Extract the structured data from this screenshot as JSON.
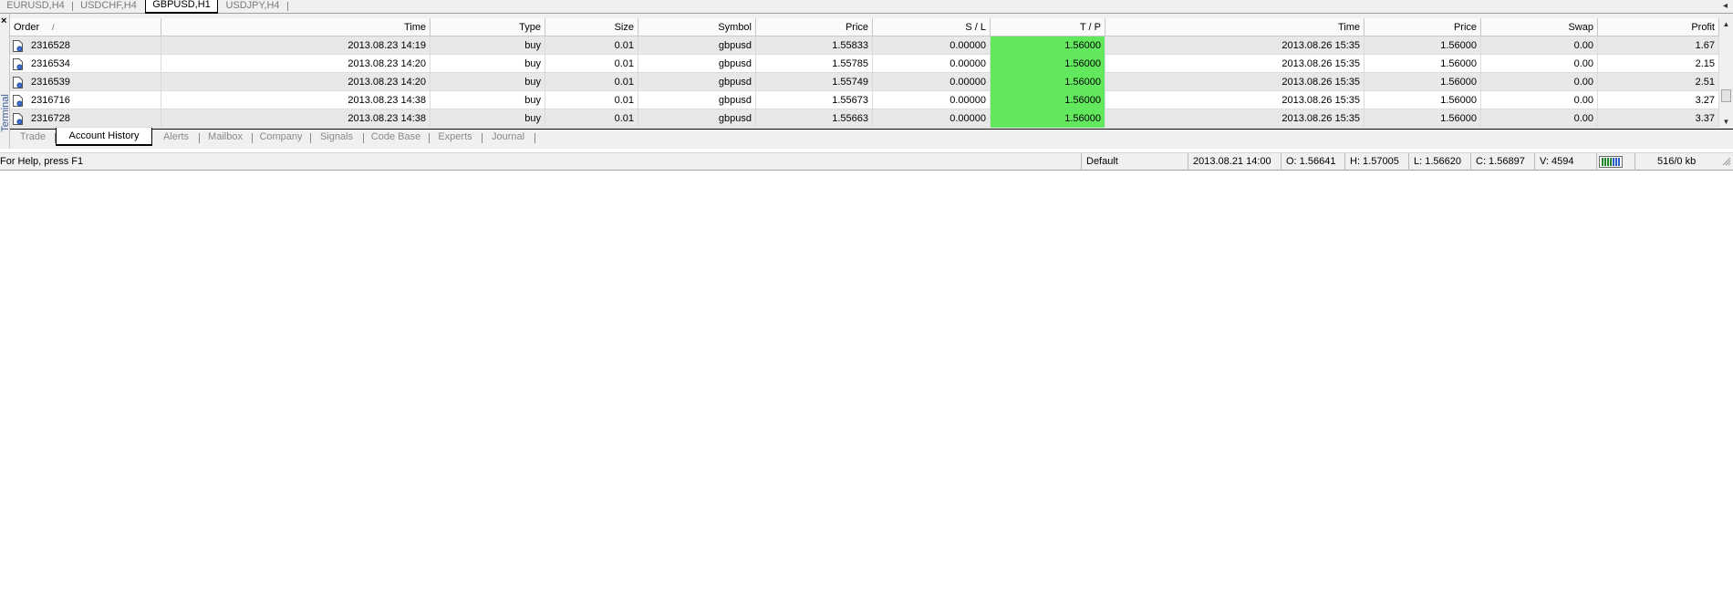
{
  "chart_tabs": [
    {
      "label": "EURUSD,H4",
      "active": false
    },
    {
      "label": "USDCHF,H4",
      "active": false
    },
    {
      "label": "GBPUSD,H1",
      "active": true
    },
    {
      "label": "USDJPY,H4",
      "active": false
    }
  ],
  "terminal": {
    "side_label": "Terminal",
    "close_glyph": "×",
    "columns": [
      "Order",
      "Time",
      "Type",
      "Size",
      "Symbol",
      "Price",
      "S / L",
      "T / P",
      "Time",
      "Price",
      "Swap",
      "Profit"
    ],
    "sort_indicator": "/",
    "rows": [
      [
        "2316528",
        "2013.08.23 14:19",
        "buy",
        "0.01",
        "gbpusd",
        "1.55833",
        "0.00000",
        "1.56000",
        "2013.08.26 15:35",
        "1.56000",
        "0.00",
        "1.67"
      ],
      [
        "2316534",
        "2013.08.23 14:20",
        "buy",
        "0.01",
        "gbpusd",
        "1.55785",
        "0.00000",
        "1.56000",
        "2013.08.26 15:35",
        "1.56000",
        "0.00",
        "2.15"
      ],
      [
        "2316539",
        "2013.08.23 14:20",
        "buy",
        "0.01",
        "gbpusd",
        "1.55749",
        "0.00000",
        "1.56000",
        "2013.08.26 15:35",
        "1.56000",
        "0.00",
        "2.51"
      ],
      [
        "2316716",
        "2013.08.23 14:38",
        "buy",
        "0.01",
        "gbpusd",
        "1.55673",
        "0.00000",
        "1.56000",
        "2013.08.26 15:35",
        "1.56000",
        "0.00",
        "3.27"
      ],
      [
        "2316728",
        "2013.08.23 14:38",
        "buy",
        "0.01",
        "gbpusd",
        "1.55663",
        "0.00000",
        "1.56000",
        "2013.08.26 15:35",
        "1.56000",
        "0.00",
        "3.37"
      ]
    ],
    "tp_highlight_color": "#62e85c",
    "tabs": [
      {
        "label": "Trade",
        "active": false
      },
      {
        "label": "Account History",
        "active": true
      },
      {
        "label": "Alerts",
        "active": false
      },
      {
        "label": "Mailbox",
        "active": false
      },
      {
        "label": "Company",
        "active": false
      },
      {
        "label": "Signals",
        "active": false
      },
      {
        "label": "Code Base",
        "active": false
      },
      {
        "label": "Experts",
        "active": false
      },
      {
        "label": "Journal",
        "active": false
      }
    ]
  },
  "statusbar": {
    "help": "For Help, press F1",
    "profile": "Default",
    "datetime": "2013.08.21 14:00",
    "open": "O: 1.56641",
    "high": "H: 1.57005",
    "low": "L: 1.56620",
    "close": "C: 1.56897",
    "volume": "V: 4594",
    "traffic": "516/0 kb"
  },
  "icons": {
    "order_row": "order-document-icon",
    "connection": "connection-bars-icon",
    "scroll_up": "▲",
    "scroll_down": "▼",
    "scroll_left": "◂"
  }
}
